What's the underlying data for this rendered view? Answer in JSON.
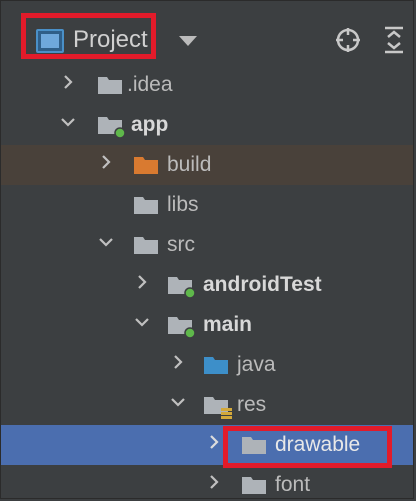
{
  "toolbar": {
    "view_label": "Project",
    "dropdown_icon": "chevron-down-icon",
    "locate_icon": "crosshair-icon",
    "collapse_icon": "collapse-all-icon"
  },
  "tree": {
    "items": [
      {
        "label": "idea_folder",
        "text": ".idea"
      },
      {
        "label": "app",
        "text": "app"
      },
      {
        "label": "build",
        "text": "build"
      },
      {
        "label": "libs",
        "text": "libs"
      },
      {
        "label": "src",
        "text": "src"
      },
      {
        "label": "androidTest",
        "text": "androidTest"
      },
      {
        "label": "main",
        "text": "main"
      },
      {
        "label": "java",
        "text": "java"
      },
      {
        "label": "res",
        "text": "res"
      },
      {
        "label": "drawable",
        "text": "drawable"
      },
      {
        "label": "font",
        "text": "font"
      }
    ]
  },
  "colors": {
    "panel_bg": "#3c3f41",
    "selection": "#4b6eaf",
    "excluded_row": "#49413a",
    "highlight_box": "#e21b2a",
    "folder_gray": "#aeb3b8",
    "folder_orange": "#d97a30",
    "folder_blue": "#3d8fc9",
    "module_dot": "#5fb84b"
  }
}
